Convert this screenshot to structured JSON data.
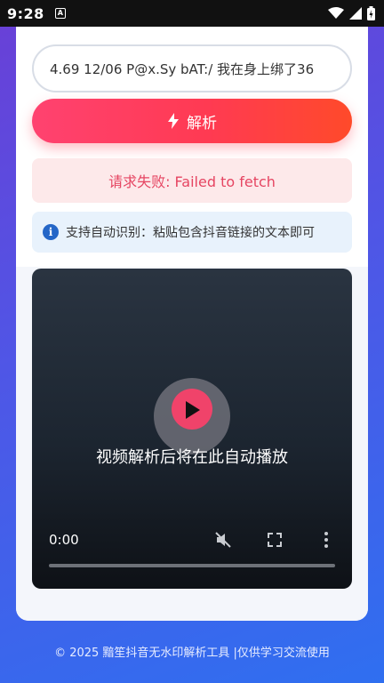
{
  "status_bar": {
    "time": "9:28",
    "notification_icon": "A"
  },
  "input": {
    "value": "4.69 12/06 P@x.Sy bAT:/ 我在身上绑了36"
  },
  "parse_button": {
    "label": "解析",
    "icon": "bolt-icon"
  },
  "error": {
    "message": "请求失败: Failed to fetch"
  },
  "info": {
    "icon": "info-icon",
    "message": "支持自动识别：粘贴包含抖音链接的文本即可"
  },
  "video": {
    "caption": "视频解析后将在此自动播放",
    "current_time": "0:00",
    "progress": 0
  },
  "footer": {
    "text": "© 2025 黯笙抖音无水印解析工具 |仅供学习交流使用"
  }
}
